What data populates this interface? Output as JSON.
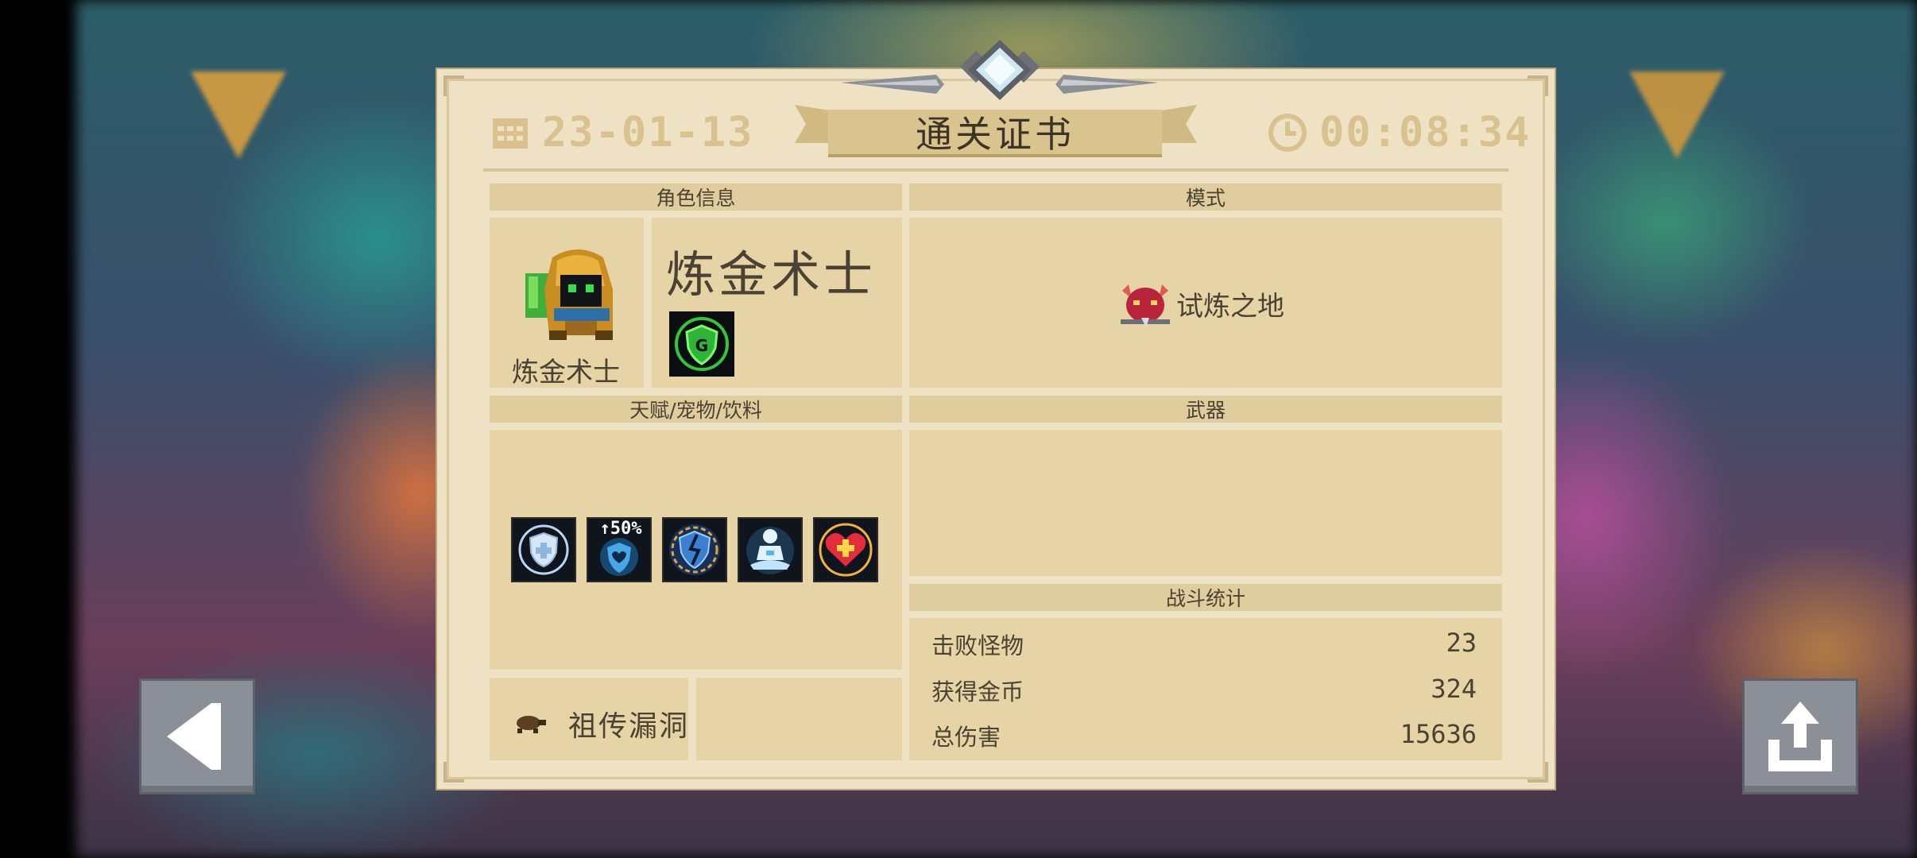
{
  "header": {
    "date": "23-01-13",
    "title": "通关证书",
    "time": "00:08:34"
  },
  "character": {
    "section_title": "角色信息",
    "name_small": "炼金术士",
    "name_big": "炼金术士",
    "skill_icon": "green-shield-skill-icon",
    "portrait_icon": "alchemist-portrait-icon"
  },
  "mode": {
    "section_title": "模式",
    "label": "试炼之地",
    "icon": "red-demon-helmet-icon"
  },
  "talents": {
    "section_title": "天赋/宠物/饮料",
    "items": [
      {
        "icon": "shield-buff-icon",
        "badge": ""
      },
      {
        "icon": "heart-shield-50-icon",
        "badge": "↑50%"
      },
      {
        "icon": "broken-shield-icon",
        "badge": ""
      },
      {
        "icon": "meditating-figure-icon",
        "badge": ""
      },
      {
        "icon": "heart-plus-icon",
        "badge": ""
      }
    ]
  },
  "relic": {
    "label": "祖传漏洞",
    "icon": "turtle-icon"
  },
  "weapons": {
    "section_title": "武器"
  },
  "stats": {
    "section_title": "战斗统计",
    "rows": [
      {
        "label": "击败怪物",
        "value": "23"
      },
      {
        "label": "获得金币",
        "value": "324"
      },
      {
        "label": "总伤害",
        "value": "15636"
      }
    ]
  },
  "buttons": {
    "back_icon": "back-arrow-icon",
    "share_icon": "share-icon"
  },
  "colors": {
    "parchment": "#efe2c4",
    "panel": "#e6d4a6",
    "text": "#4b4233",
    "header_text": "#d9c28f"
  }
}
